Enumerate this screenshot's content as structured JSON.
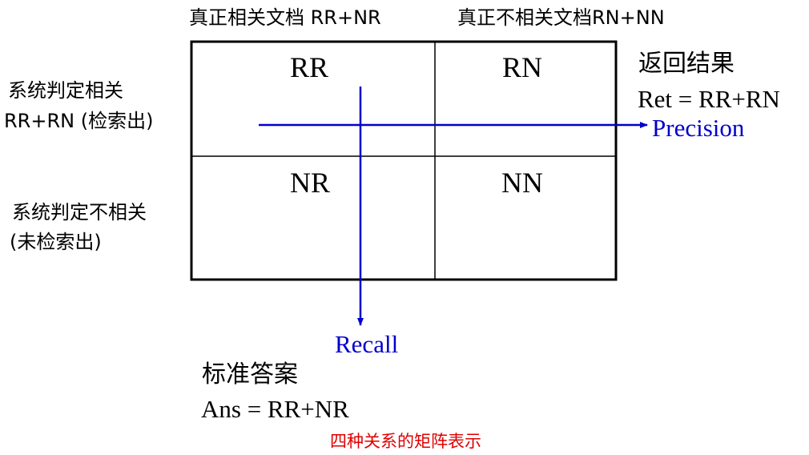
{
  "columns": {
    "relevant": "真正相关文档 RR+NR",
    "nonrelevant": "真正不相关文档RN+NN"
  },
  "rows": {
    "retrieved_line1": "系统判定相关",
    "retrieved_line2": "RR+RN (检索出)",
    "notretrieved_line1": "系统判定不相关",
    "notretrieved_line2": "(未检索出)"
  },
  "cells": {
    "rr": "RR",
    "rn": "RN",
    "nr": "NR",
    "nn": "NN"
  },
  "returned": {
    "title": "返回结果",
    "formula": "Ret = RR+RN"
  },
  "answer": {
    "title": "标准答案",
    "formula": "Ans = RR+NR"
  },
  "arrows": {
    "precision": "Precision",
    "recall": "Recall"
  },
  "caption": "四种关系的矩阵表示",
  "colors": {
    "arrow": "#0000cc",
    "caption": "#e00000",
    "grid": "#000000"
  }
}
